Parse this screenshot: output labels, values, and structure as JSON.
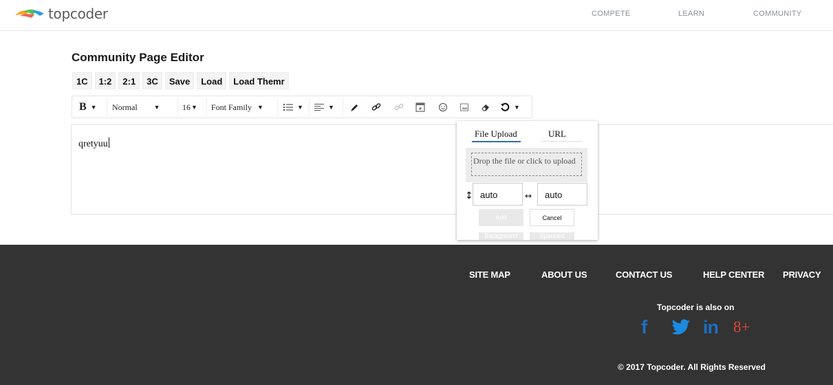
{
  "nav": {
    "brand": "topcoder",
    "links": [
      "COMPETE",
      "LEARN",
      "COMMUNITY"
    ]
  },
  "editor": {
    "title": "Community Page Editor",
    "layout_buttons": [
      "1C",
      "1:2",
      "2:1",
      "3C",
      "Save",
      "Load",
      "Load Themr"
    ],
    "toolbar": {
      "bold": "B",
      "block_type": "Normal",
      "font_size": "16",
      "font_family": "Font Family"
    },
    "content": "qretyuu"
  },
  "image_popup": {
    "tabs": [
      "File Upload",
      "URL"
    ],
    "drop_hint": "Drop the file or click to upload",
    "height_value": "auto",
    "width_value": "auto",
    "add_label": "Add",
    "cancel_label": "Cancel",
    "background_label": "Background",
    "spanned_label": "Spanned"
  },
  "footer": {
    "links": [
      "SITE MAP",
      "ABOUT US",
      "CONTACT US",
      "HELP CENTER",
      "PRIVACY"
    ],
    "also_on": "Topcoder is also on",
    "copyright": "© 2017 Topcoder. All Rights Reserved",
    "social": {
      "facebook": "f",
      "linkedin": "in",
      "googleplus": "8+"
    }
  },
  "colors": {
    "footer_bg": "#333333",
    "social_blue": "#1e6fc2",
    "googleplus_red": "#e0463a",
    "twitter_blue": "#1b8ae0"
  }
}
